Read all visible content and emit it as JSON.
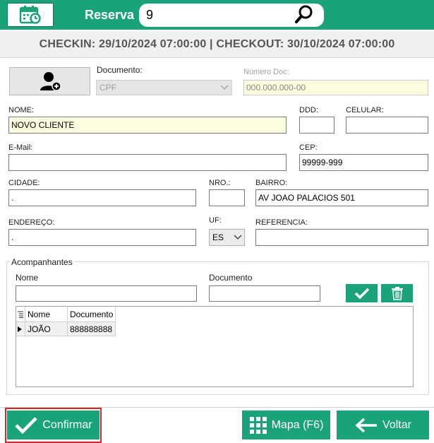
{
  "header": {
    "label": "Reserva",
    "reservation_number": "9"
  },
  "dates": {
    "text": "CHECKIN: 29/10/2024 07:00:00 | CHECKOUT: 30/10/2024 07:00:00"
  },
  "form": {
    "documento_label": "Documento:",
    "documento_value": "CPF",
    "numero_doc_label": "Número Doc:",
    "numero_doc_value": "000.000.000-00",
    "nome_label": "NOME:",
    "nome_value": "NOVO CLIENTE",
    "ddd_label": "DDD:",
    "ddd_value": "",
    "celular_label": "CELULAR:",
    "celular_value": "",
    "email_label": "E-Mail:",
    "email_value": "",
    "cep_label": "CEP:",
    "cep_value": "99999-999",
    "cidade_label": "CIDADE:",
    "cidade_value": ".",
    "nro_label": "NRO.:",
    "nro_value": "",
    "bairro_label": "BAIRRO:",
    "bairro_value": "AV JOAO  PALACIOS 501",
    "endereco_label": "ENDEREÇO:",
    "endereco_value": ".",
    "uf_label": "UF:",
    "uf_value": "ES",
    "referencia_label": "REFERENCIA:",
    "referencia_value": ""
  },
  "acompanhantes": {
    "title": "Acompanhantes",
    "nome_label": "Nome",
    "nome_value": "",
    "documento_label": "Documento",
    "documento_value": "",
    "columns": [
      "Nome",
      "Documento"
    ],
    "rows": [
      {
        "nome": "JOÃO",
        "documento": "888888888"
      }
    ]
  },
  "footer": {
    "confirmar": "Confirmar",
    "mapa": "Mapa (F6)",
    "voltar": "Voltar"
  },
  "colors": {
    "accent": "#1aa37a",
    "highlight": "#d9262c"
  }
}
